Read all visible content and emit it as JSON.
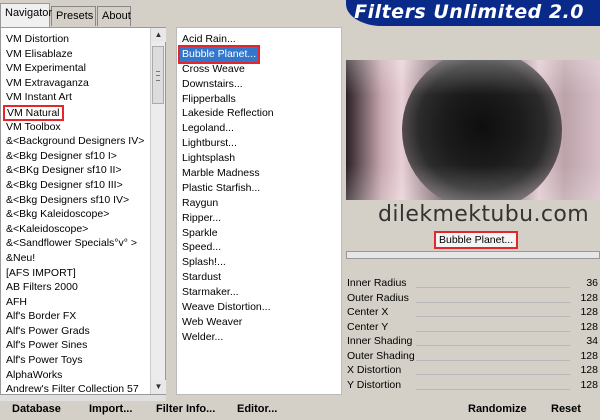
{
  "tabs": {
    "navigator": "Navigator",
    "presets": "Presets",
    "about": "About"
  },
  "brand": {
    "title": "Filters Unlimited 2.0",
    "color": "#0a2a8a"
  },
  "categories": [
    "VM Distortion",
    "VM Elisablaze",
    "VM Experimental",
    "VM Extravaganza",
    "VM Instant Art",
    "VM Natural",
    "VM Toolbox",
    "&<Background Designers IV>",
    "&<Bkg Designer sf10 I>",
    "&<BKg Designer sf10 II>",
    "&<Bkg Designer sf10 III>",
    "&<Bkg Designers sf10 IV>",
    "&<Bkg Kaleidoscope>",
    "&<Kaleidoscope>",
    "&<Sandflower Specials°v° >",
    "&Neu!",
    "[AFS IMPORT]",
    "AB Filters 2000",
    "AFH",
    "Alf's Border FX",
    "Alf's Power Grads",
    "Alf's Power Sines",
    "Alf's Power Toys",
    "AlphaWorks",
    "Andrew's Filter Collection 57"
  ],
  "filters": [
    "Acid Rain...",
    "Bubble Planet...",
    "Cross Weave",
    "Downstairs...",
    "Flipperballs",
    "Lakeside Reflection",
    "Legoland...",
    "Lightburst...",
    "Lightsplash",
    "Marble Madness",
    "Plastic Starfish...",
    "Raygun",
    "Ripper...",
    "Sparkle",
    "Speed...",
    "Splash!...",
    "Stardust",
    "Starmaker...",
    "Weave Distortion...",
    "Web Weaver",
    "Welder..."
  ],
  "selected_filter": "Bubble Planet...",
  "watermark": "dilekmektubu.com",
  "params": [
    {
      "label": "Inner Radius",
      "value": "36"
    },
    {
      "label": "Outer Radius",
      "value": "128"
    },
    {
      "label": "Center X",
      "value": "128"
    },
    {
      "label": "Center Y",
      "value": "128"
    },
    {
      "label": "Inner Shading",
      "value": "34"
    },
    {
      "label": "Outer Shading",
      "value": "128"
    },
    {
      "label": "X Distortion",
      "value": "128"
    },
    {
      "label": "Y Distortion",
      "value": "128"
    }
  ],
  "buttons": {
    "database": "Database",
    "import": "Import...",
    "filter_info": "Filter Info...",
    "editor": "Editor...",
    "randomize": "Randomize",
    "reset": "Reset"
  },
  "colors": {
    "highlight": "#e3262c",
    "selection": "#3377cc"
  }
}
